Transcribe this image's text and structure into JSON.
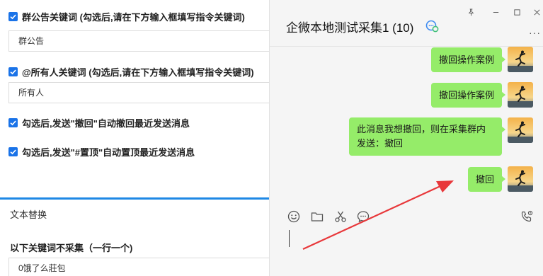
{
  "settings": {
    "announcement_keyword": {
      "label": "群公告关键词 (勾选后,请在下方输入框填写指令关键词)",
      "checked": true,
      "value": "群公告"
    },
    "mention_all_keyword": {
      "label": "@所有人关键词 (勾选后,请在下方输入框填写指令关键词)",
      "checked": true,
      "value": "所有人"
    },
    "recall_option": {
      "label": "勾选后,发送\"撤回\"自动撤回最近发送消息",
      "checked": true
    },
    "pin_option": {
      "label": "勾选后,发送\"#置顶\"自动置顶最近发送消息",
      "checked": true
    },
    "text_replace": {
      "title": "文本替换"
    },
    "exclude_keywords": {
      "title": "以下关键词不采集（一行一个)",
      "value": "0饿了么莊包"
    }
  },
  "chat": {
    "title": "企微本地测试采集1 (10)",
    "group_icon": "group-chat-icon",
    "window_controls": [
      "pin-icon",
      "minimize-icon",
      "maximize-icon",
      "close-icon"
    ],
    "more": "···",
    "messages": [
      {
        "text": "撤回操作案例"
      },
      {
        "text": "撤回操作案例"
      },
      {
        "text": "此消息我想撤回，则在采集群内发送：撤回"
      },
      {
        "text": "撤回"
      }
    ],
    "toolbar": [
      "emoji-icon",
      "folder-icon",
      "screenshot-icon",
      "chat-history-icon",
      "voice-call-icon"
    ],
    "accent_color": "#95ec69"
  },
  "annotation": {
    "arrow_color": "#e8373a"
  }
}
